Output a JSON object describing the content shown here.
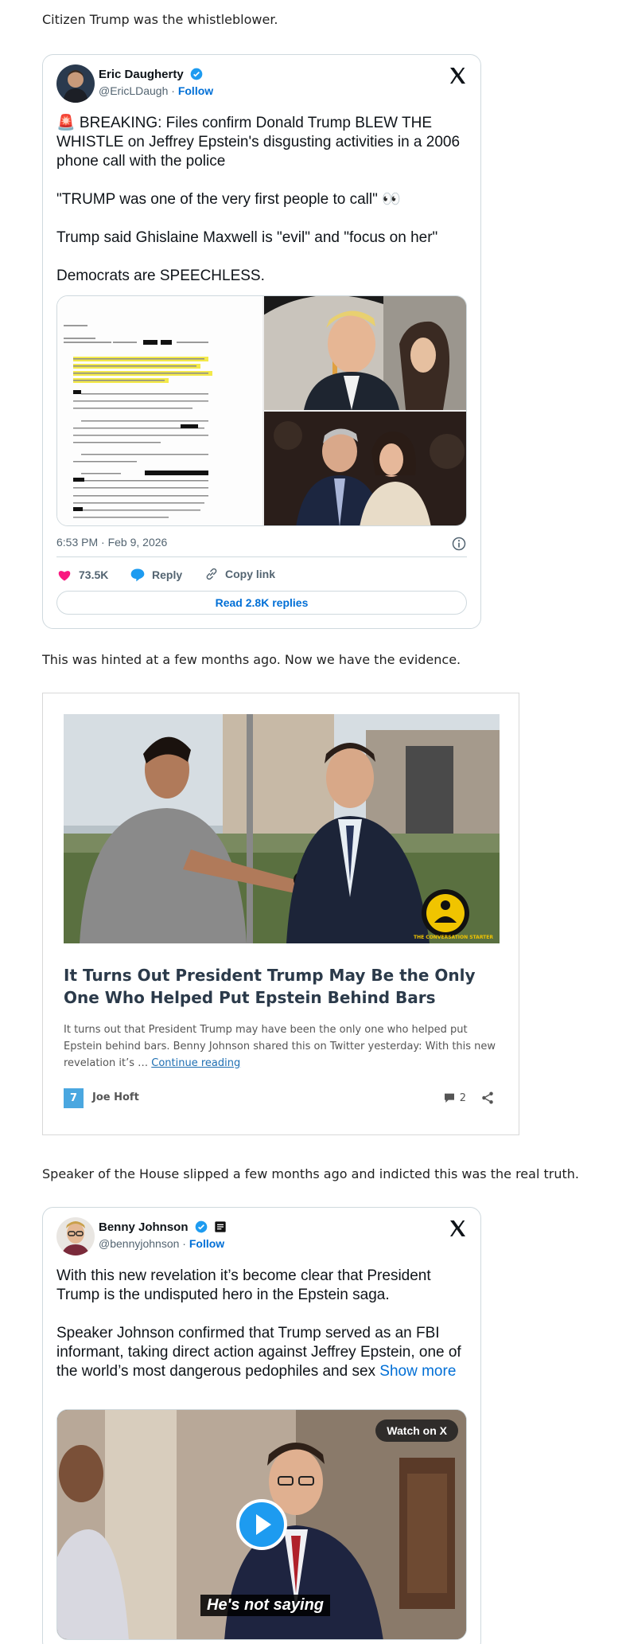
{
  "paragraphs": {
    "p1": "Citizen Trump was the whistleblower.",
    "p2": "This was hinted at a few months ago.  Now we have the evidence.",
    "p3": "Speaker of the House slipped a few months ago and indicted this was the real truth."
  },
  "tweet1": {
    "name": "Eric Daugherty",
    "handle": "@EricLDaugh",
    "separator": " · ",
    "follow": "Follow",
    "text_1": "🚨 BREAKING: Files confirm Donald Trump BLEW THE WHISTLE on Jeffrey Epstein's disgusting activities in a 2006 phone call with the police",
    "text_2": "\"TRUMP was one of the very first people to call\" 👀",
    "text_3": "Trump said Ghislaine Maxwell is \"evil\" and \"focus on her\"",
    "text_4": "Democrats are SPEECHLESS.",
    "timestamp": "6:53 PM · Feb 9, 2026",
    "likes": "73.5K",
    "reply": "Reply",
    "copy_link": "Copy link",
    "read_replies": "Read 2.8K replies"
  },
  "article": {
    "title": "It Turns Out President Trump May Be the Only One Who Helped Put Epstein Behind Bars",
    "excerpt": "It turns out that President Trump may have been the only one who helped put Epstein behind bars.  Benny Johnson shared this on Twitter yesterday: With this new revelation it’s … ",
    "continue": "Continue reading",
    "site_icon_text": "7",
    "author": "Joe Hoft",
    "comments": "2",
    "watermark": "THE CONVERSATION STARTER"
  },
  "tweet2": {
    "name": "Benny Johnson",
    "handle": "@bennyjohnson",
    "separator": " · ",
    "follow": "Follow",
    "text_1": "With this new revelation it’s become clear that President Trump is the undisputed hero in the Epstein saga.",
    "text_2": "Speaker Johnson confirmed that Trump served as an FBI informant, taking direct action against Jeffrey Epstein, one of the world’s most dangerous pedophiles and sex ",
    "show_more": "Show more",
    "watch_on_x": "Watch on X",
    "caption": "He's not saying"
  },
  "colors": {
    "link_blue": "#006fd6",
    "verified_blue": "#1d9bf0",
    "like_pink": "#f91880",
    "border": "#cfd9de"
  }
}
